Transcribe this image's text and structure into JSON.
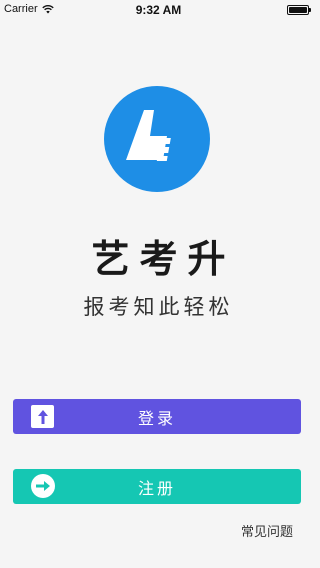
{
  "status_bar": {
    "carrier": "Carrier",
    "time": "9:32 AM",
    "battery_level": 1.0
  },
  "app": {
    "logo_icon": "app-logo-icon",
    "title": "艺考升",
    "slogan": "报考知此轻松"
  },
  "buttons": {
    "login_label": "登录",
    "login_icon": "upload-arrow-icon",
    "register_label": "注册",
    "register_icon": "right-arrow-icon"
  },
  "links": {
    "faq": "常见问题"
  },
  "colors": {
    "login": "#6053e0",
    "register": "#15c7b3",
    "logo": "#1e8ee6"
  }
}
